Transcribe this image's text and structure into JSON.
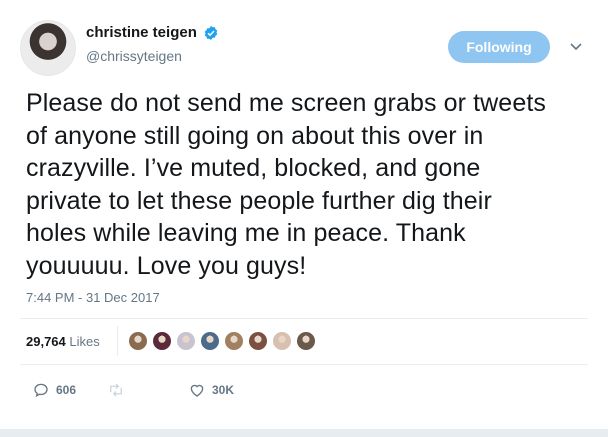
{
  "author": {
    "name": "christine teigen",
    "handle": "@chrissyteigen"
  },
  "follow_button": {
    "label": "Following"
  },
  "tweet": {
    "lines": [
      "Please do not send me screen grabs or tweets",
      "of anyone still going on about this over in",
      "crazyville. I’ve muted, blocked, and gone",
      "private to let these people further dig their",
      "holes while leaving me in peace. Thank",
      "youuuuu. Love you guys!"
    ],
    "timestamp": "7:44 PM - 31 Dec 2017"
  },
  "stats": {
    "likes_count": "29,764",
    "likes_label": "Likes"
  },
  "liker_avatars": [
    "#8a6b4f",
    "#5a2a3a",
    "#c9c3cf",
    "#4c6a8a",
    "#a08060",
    "#7a5040",
    "#d8c0b0",
    "#6a5a4a"
  ],
  "actions": {
    "reply_count": "606",
    "retweet_count": "",
    "like_count": "30K"
  },
  "colors": {
    "accent": "#1da1f2",
    "follow_button_bg": "#8ec5f1",
    "muted_text": "#657786",
    "verified": "#1da1f2"
  },
  "icons": [
    "verified-badge-icon",
    "chevron-down-icon",
    "reply-icon",
    "retweet-icon",
    "heart-icon"
  ]
}
